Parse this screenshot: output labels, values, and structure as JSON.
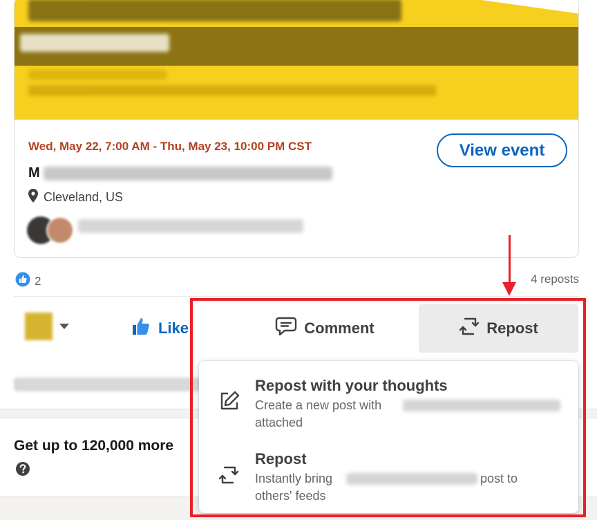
{
  "event": {
    "date_range": "Wed, May 22, 7:00 AM - Thu, May 23, 10:00 PM CST",
    "view_event_label": "View event",
    "title_lead": "M",
    "location": "Cleveland, US"
  },
  "social": {
    "reaction_count": "2",
    "reposts": "4 reposts"
  },
  "actions": {
    "like_label": "Like",
    "comment_label": "Comment",
    "repost_label": "Repost"
  },
  "promo": {
    "title": "Get up to 120,000 more"
  },
  "repost_menu": {
    "items": [
      {
        "title": "Repost with your thoughts",
        "desc_prefix": "Create a new post with",
        "desc_suffix": "attached"
      },
      {
        "title": "Repost",
        "desc_prefix": "Instantly bring",
        "desc_middle": "post to",
        "desc_suffix": "others' feeds"
      }
    ]
  },
  "colors": {
    "accent_blue": "#0a66c2",
    "date_orange": "#b24020",
    "banner_yellow": "#f7cf1e",
    "annotation_red": "#e8202a"
  }
}
